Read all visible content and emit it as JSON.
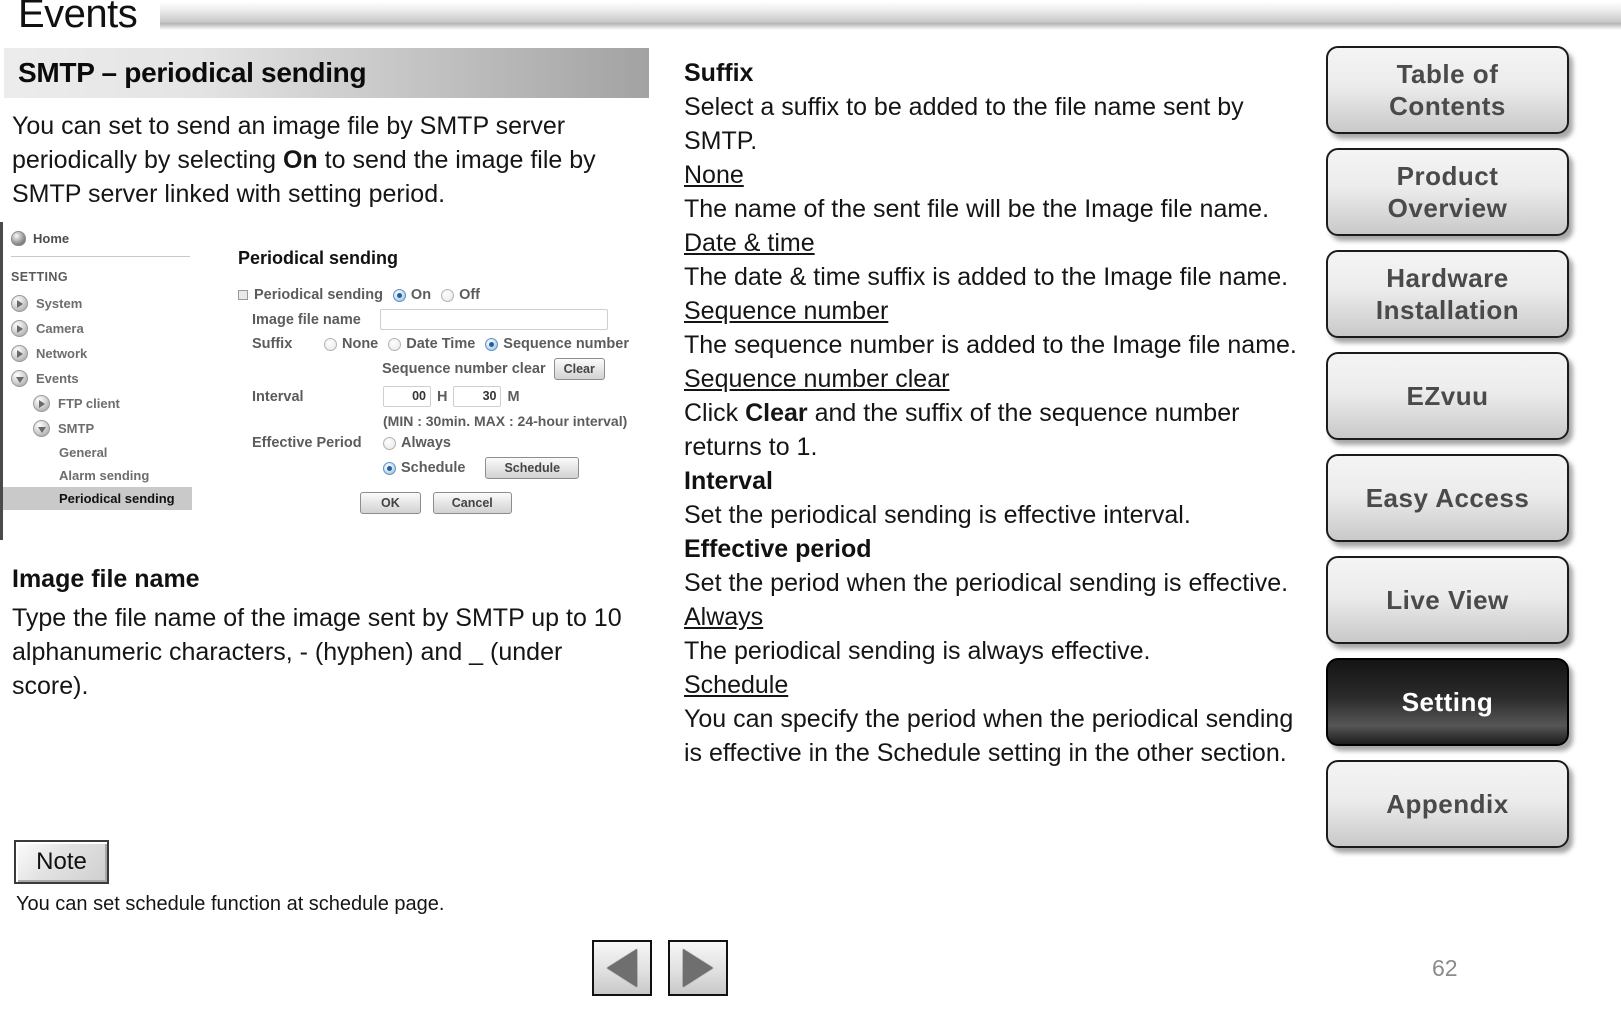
{
  "header": {
    "tab_label": "Events"
  },
  "section": {
    "title": "SMTP – periodical sending",
    "intro_part1": "You can set to send an image file by SMTP server periodically by selecting ",
    "intro_bold": "On",
    "intro_part2": " to send the image file by SMTP server linked with setting period."
  },
  "screenshot": {
    "sidebar": {
      "home_label": "Home",
      "section_label": "SETTING",
      "items": [
        {
          "label": "System",
          "icon": "arrow-right-icon",
          "level": 0,
          "active": false
        },
        {
          "label": "Camera",
          "icon": "arrow-right-icon",
          "level": 0,
          "active": false
        },
        {
          "label": "Network",
          "icon": "arrow-right-icon",
          "level": 0,
          "active": false
        },
        {
          "label": "Events",
          "icon": "arrow-down-icon",
          "level": 0,
          "active": false
        },
        {
          "label": "FTP client",
          "icon": "arrow-right-icon",
          "level": 1,
          "active": false
        },
        {
          "label": "SMTP",
          "icon": "arrow-down-icon",
          "level": 1,
          "active": false
        },
        {
          "label": "General",
          "icon": "none",
          "level": 2,
          "active": false
        },
        {
          "label": "Alarm sending",
          "icon": "none",
          "level": 2,
          "active": false
        },
        {
          "label": "Periodical sending",
          "icon": "none",
          "level": 2,
          "active": true
        }
      ]
    },
    "form": {
      "title": "Periodical sending",
      "periodical_sending_label": "Periodical sending",
      "on_label": "On",
      "off_label": "Off",
      "on_selected": true,
      "image_file_name_label": "Image file name",
      "image_file_name_value": "",
      "suffix_label": "Suffix",
      "suffix_none_label": "None",
      "suffix_datetime_label": "Date Time",
      "suffix_sequence_label": "Sequence number",
      "suffix_selected": "Sequence number",
      "sequence_clear_label": "Sequence number clear",
      "clear_button": "Clear",
      "interval_label": "Interval",
      "interval_hours": "00",
      "interval_hours_unit": "H",
      "interval_minutes": "30",
      "interval_minutes_unit": "M",
      "interval_hint": "(MIN : 30min. MAX : 24-hour interval)",
      "effective_period_label": "Effective Period",
      "always_label": "Always",
      "schedule_label": "Schedule",
      "schedule_button": "Schedule",
      "effective_period_selected": "Schedule",
      "ok_button": "OK",
      "cancel_button": "Cancel"
    }
  },
  "left_column": {
    "image_file_name_heading": "Image file name",
    "image_file_name_body": "Type the file name of the image sent by SMTP up to 10 alphanumeric characters, - (hyphen) and _ (under score).",
    "note_button": "Note",
    "note_text": "You can set schedule function at schedule page."
  },
  "right_column": {
    "blocks": [
      {
        "style": "heading",
        "text": "Suffix"
      },
      {
        "style": "paragraph",
        "text": "Select a suffix to be added to the file name sent by SMTP."
      },
      {
        "style": "underline",
        "text": "None"
      },
      {
        "style": "paragraph",
        "text": "The name of the sent file will be the Image file name."
      },
      {
        "style": "underline",
        "text": "Date & time"
      },
      {
        "style": "paragraph",
        "text": "The date & time suffix is added to the Image file name."
      },
      {
        "style": "underline",
        "text": "Sequence number"
      },
      {
        "style": "paragraph",
        "text": "The sequence number is added to the Image file name."
      },
      {
        "style": "underline",
        "text": "Sequence number clear"
      },
      {
        "style": "paragraph-bold-clear",
        "text_before": "Click ",
        "bold": "Clear",
        "text_after": " and the suffix of the sequence number returns to 1."
      },
      {
        "style": "heading",
        "text": "Interval"
      },
      {
        "style": "paragraph",
        "text": "Set the periodical sending is effective interval."
      },
      {
        "style": "heading",
        "text": "Effective period"
      },
      {
        "style": "paragraph",
        "text": "Set the period when the periodical sending is effective."
      },
      {
        "style": "underline",
        "text": "Always"
      },
      {
        "style": "paragraph",
        "text": "The periodical sending is always effective."
      },
      {
        "style": "underline",
        "text": "Schedule"
      },
      {
        "style": "paragraph",
        "text": "You can specify the period when the periodical sending is effective in the Schedule setting in the other section."
      }
    ]
  },
  "nav_buttons": [
    {
      "label": "Table of\nContents",
      "active": false
    },
    {
      "label": "Product\nOverview",
      "active": false
    },
    {
      "label": "Hardware\nInstallation",
      "active": false
    },
    {
      "label": "EZvuu",
      "active": false
    },
    {
      "label": "Easy Access",
      "active": false
    },
    {
      "label": "Live View",
      "active": false
    },
    {
      "label": "Setting",
      "active": true
    },
    {
      "label": "Appendix",
      "active": false
    }
  ],
  "pager": {
    "prev_icon": "triangle-left-icon",
    "next_icon": "triangle-right-icon"
  },
  "page_number": "62"
}
